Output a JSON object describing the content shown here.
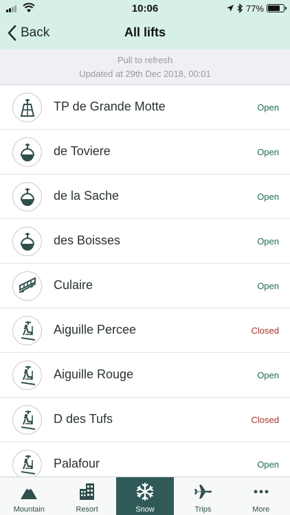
{
  "colors": {
    "header_bg": "#d7f0e6",
    "accent": "#2f5a57",
    "status_open": "#1d6b56",
    "status_closed": "#a8322a"
  },
  "status_bar": {
    "time": "10:06",
    "battery_text": "77%",
    "battery_level": 0.77,
    "icons": [
      "signal-icon",
      "wifi-icon",
      "location-arrow-icon",
      "bluetooth-icon",
      "battery-icon"
    ]
  },
  "nav": {
    "back_label": "Back",
    "title": "All lifts"
  },
  "refresh": {
    "hint": "Pull to refresh",
    "updated": "Updated at 29th Dec 2018, 00:01"
  },
  "lifts": [
    {
      "name": "TP de Grande Motte",
      "status": "Open",
      "icon": "cable-car-icon"
    },
    {
      "name": "de Toviere",
      "status": "Open",
      "icon": "gondola-icon"
    },
    {
      "name": "de la Sache",
      "status": "Open",
      "icon": "gondola-icon"
    },
    {
      "name": "des Boisses",
      "status": "Open",
      "icon": "gondola-icon"
    },
    {
      "name": "Culaire",
      "status": "Open",
      "icon": "funicular-icon"
    },
    {
      "name": "Aiguille Percee",
      "status": "Closed",
      "icon": "chairlift-icon"
    },
    {
      "name": "Aiguille Rouge",
      "status": "Open",
      "icon": "chairlift-icon"
    },
    {
      "name": "D  des Tufs",
      "status": "Closed",
      "icon": "chairlift-icon"
    },
    {
      "name": "Palafour",
      "status": "Open",
      "icon": "chairlift-icon"
    }
  ],
  "tabs": [
    {
      "label": "Mountain",
      "icon": "mountain-icon",
      "active": false
    },
    {
      "label": "Resort",
      "icon": "building-icon",
      "active": false
    },
    {
      "label": "Snow",
      "icon": "snowflake-icon",
      "active": true
    },
    {
      "label": "Trips",
      "icon": "airplane-icon",
      "active": false
    },
    {
      "label": "More",
      "icon": "more-dots-icon",
      "active": false
    }
  ]
}
